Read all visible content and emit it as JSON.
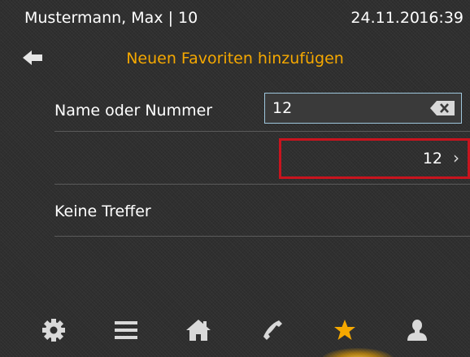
{
  "status": {
    "user": "Mustermann, Max | 10",
    "date": "24.11.20",
    "time": "16:39"
  },
  "header": {
    "title": "Neuen Favoriten hinzufügen"
  },
  "form": {
    "name_label": "Name oder Nummer",
    "search_value": "12"
  },
  "results": [
    {
      "number": "12"
    }
  ],
  "no_results_text": "Keine Treffer",
  "nav": {
    "items": [
      "settings-icon",
      "menu-icon",
      "home-icon",
      "phone-icon",
      "favorites-icon",
      "contacts-icon"
    ],
    "active": "favorites-icon"
  },
  "colors": {
    "accent": "#f5a800",
    "highlight_border": "#c8141e",
    "input_border": "#9ec6dc",
    "background": "#2f2f2f"
  }
}
